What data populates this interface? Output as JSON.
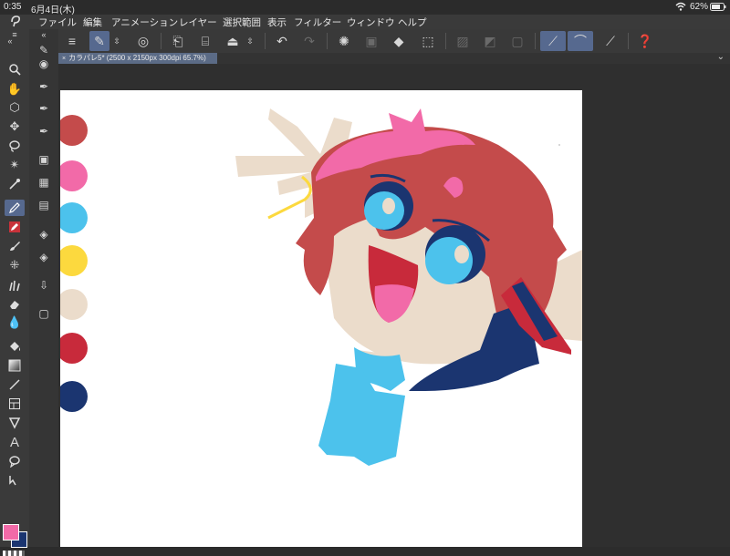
{
  "status": {
    "time": "0:35",
    "date": "6月4日(木)",
    "battery": "62%"
  },
  "menu": [
    "ファイル",
    "編集",
    "アニメーション",
    "レイヤー",
    "選択範囲",
    "表示",
    "フィルター",
    "ウィンドウ",
    "ヘルプ"
  ],
  "tab": {
    "title": "カラパレ5* (2500 x 2150px 300dpi 65.7%)"
  },
  "palette": [
    "#c44b4b",
    "#f26aa8",
    "#4cc2ec",
    "#fcd93e",
    "#ebdccb",
    "#c82a3b",
    "#1b3570"
  ],
  "colors": {
    "foreground": "#f26aa8",
    "background": "#1b3570",
    "accent": "#56698f"
  },
  "text_tool_label": "A"
}
